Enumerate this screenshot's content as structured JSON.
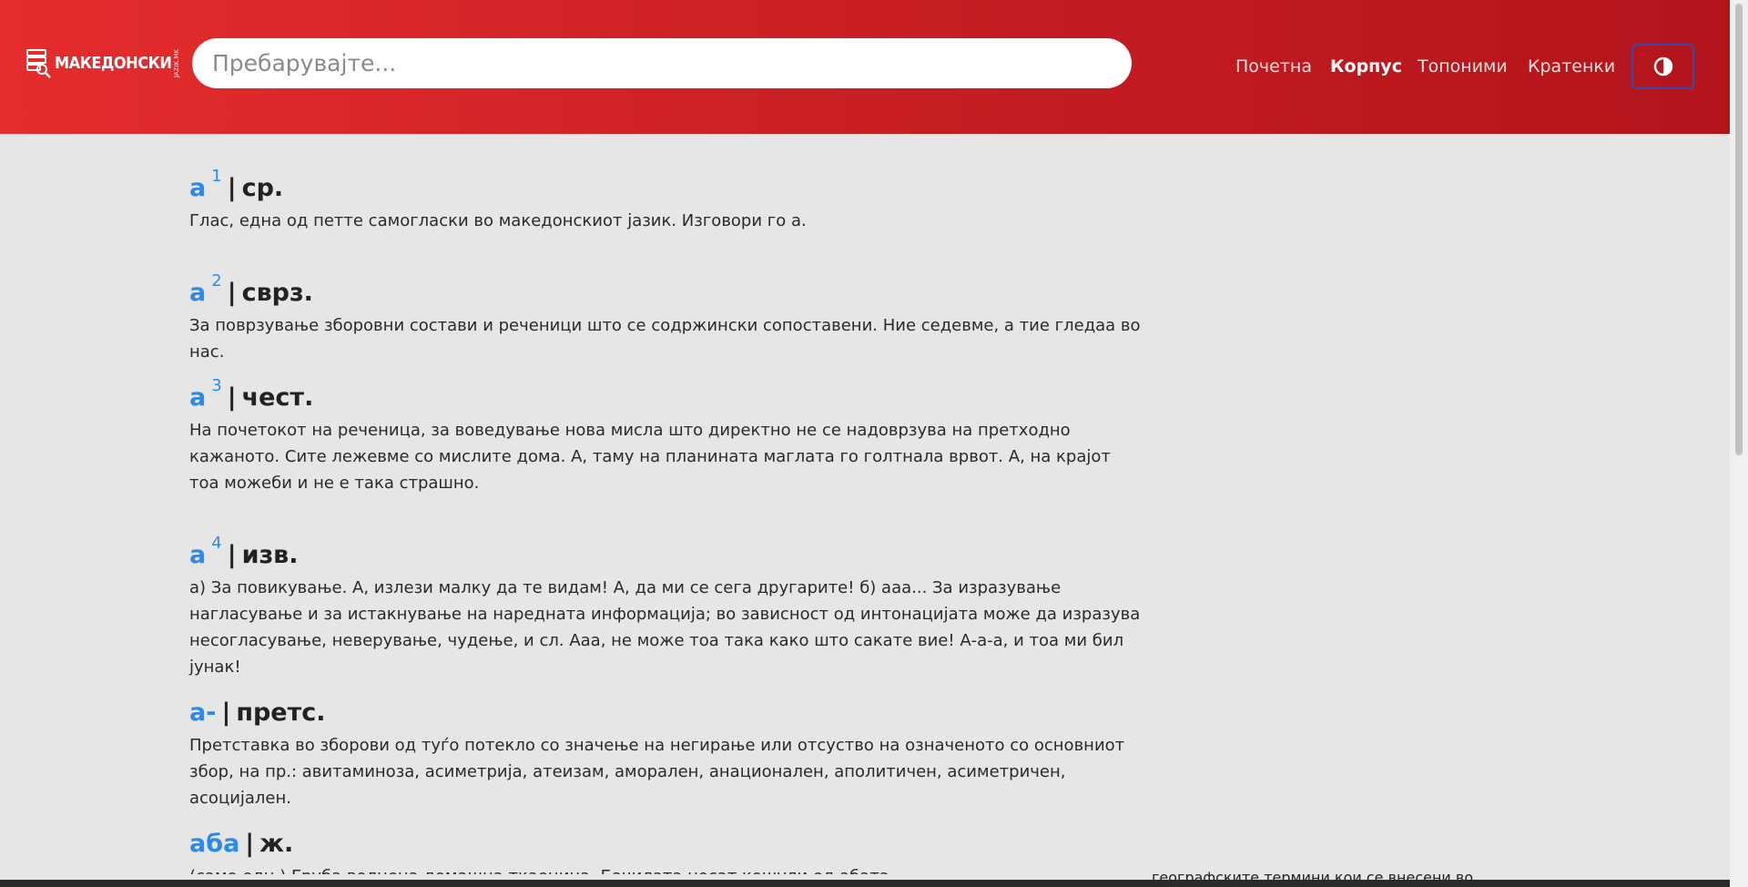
{
  "header": {
    "logo_text": "МАКЕДОНСКИ",
    "logo_domain": "JAZIK.MK",
    "search_placeholder": "Пребарувајте...",
    "nav": [
      {
        "label": "Почетна",
        "active": false
      },
      {
        "label": "Корпус",
        "active": true
      },
      {
        "label": "Топоними",
        "active": false
      },
      {
        "label": "Кратенки",
        "active": false
      }
    ],
    "theme_icon": "contrast-icon"
  },
  "entries": [
    {
      "headword": "а",
      "superscript": "1",
      "separator": "|",
      "pos": "ср.",
      "definition": "Глас, една од петте самогласки во македонскиот јазик. Изговори го а."
    },
    {
      "headword": "а",
      "superscript": "2",
      "separator": "|",
      "pos": "сврз.",
      "definition": "За поврзување зборовни состави и реченици што се содржински сопоставени. Ние седевме, а тие гледаа во нас."
    },
    {
      "headword": "а",
      "superscript": "3",
      "separator": "|",
      "pos": "чест.",
      "definition": "На почетокот на реченица, за воведување нова мисла што директно не се надоврзува на претходно кажаното. Сите лежевме со мислите дома. А, таму на планината маглата го голтнала врвот. А, на крајот тоа можеби и не е така страшно."
    },
    {
      "headword": "а",
      "superscript": "4",
      "separator": "|",
      "pos": "изв.",
      "definition": "а) За повикување. А, излези малку да те видам! А, да ми се сега другарите! б) ааа... За изразување нагласување и за истакнување на наредната информација; во зависност од интонацијата може да изразува несогласување, неверување, чудење, и сл. Ааа, не може тоа така како што сакате вие! А-а-а, и тоа ми бил јунак!"
    },
    {
      "headword": "а-",
      "superscript": "",
      "separator": "|",
      "pos": "претс.",
      "definition": "Претставка во зборови од туѓо потекло со значење на негирање или отсуство на означеното со основниот збор, на пр.: авитаминоза, асиметрија, атеизам, аморален, анационален, аполитичен, асиметричен, асоцијален."
    },
    {
      "headword": "аба",
      "superscript": "",
      "separator": "|",
      "pos": "ж.",
      "definition": "(само едн.) Груба волнена домашна ткаенина. Бачилата носат кошули од абата"
    }
  ],
  "colors": {
    "header_start": "#e52d2d",
    "header_end": "#b3141b",
    "headword": "#2d8ae8",
    "background": "#e6e6e6"
  },
  "footer_fragment": "географските термини кои се внесени во"
}
